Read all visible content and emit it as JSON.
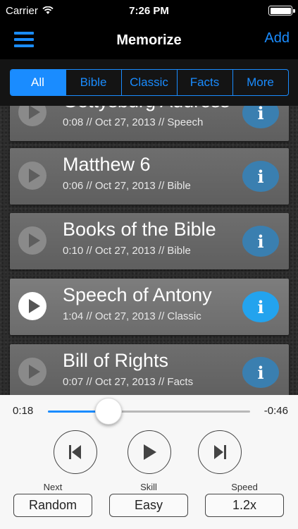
{
  "status_bar": {
    "carrier": "Carrier",
    "time": "7:26 PM",
    "battery_level": 1.0
  },
  "nav": {
    "title": "Memorize",
    "add_label": "Add"
  },
  "segments": [
    {
      "label": "All",
      "active": true
    },
    {
      "label": "Bible",
      "active": false
    },
    {
      "label": "Classic",
      "active": false
    },
    {
      "label": "Facts",
      "active": false
    },
    {
      "label": "More",
      "active": false
    }
  ],
  "items": [
    {
      "title": "Gettysburg Address",
      "meta": "0:08 // Oct 27, 2013 // Speech"
    },
    {
      "title": "Matthew 6",
      "meta": "0:06 // Oct 27, 2013 // Bible"
    },
    {
      "title": "Books of the Bible",
      "meta": "0:10 // Oct 27, 2013 // Bible"
    },
    {
      "title": "Speech of Antony",
      "meta": "1:04 // Oct 27, 2013 // Classic"
    },
    {
      "title": "Bill of Rights",
      "meta": "0:07 // Oct 27, 2013 // Facts"
    }
  ],
  "player": {
    "elapsed": "0:18",
    "remaining": "-0:46",
    "progress": 0.3,
    "next_label": "Next",
    "next_value": "Random",
    "skill_label": "Skill",
    "skill_value": "Easy",
    "speed_label": "Speed",
    "speed_value": "1.2x"
  },
  "colors": {
    "accent": "#1a8cff",
    "info_selected": "#23a3ee",
    "info_normal": "#3a7fb0"
  }
}
